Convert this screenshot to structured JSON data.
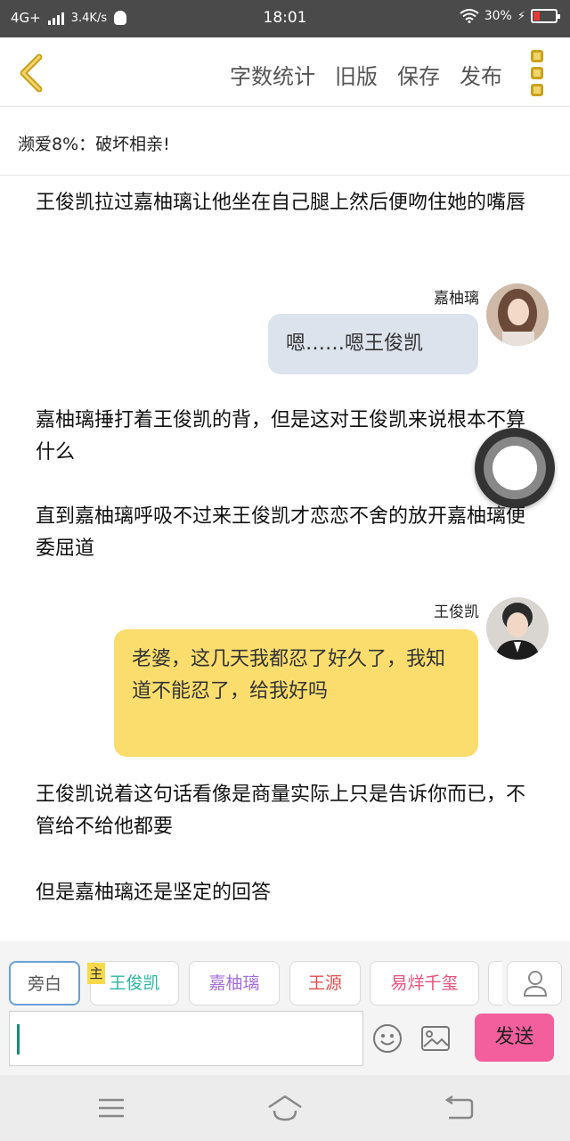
{
  "status_bar": {
    "network": "4G+",
    "speed": "3.4K/s",
    "time": "18:01",
    "battery": "30%",
    "battery_level": 0.3
  },
  "top_bar": {
    "actions": [
      "字数统计",
      "旧版",
      "保存",
      "发布"
    ]
  },
  "chapter": {
    "title": "濒爱8%：破坏相亲!"
  },
  "story": {
    "para1": "王俊凯拉过嘉柚璃让他坐在自己腿上然后便吻住她的嘴唇",
    "msg1": {
      "speaker": "嘉柚璃",
      "text": "嗯……嗯王俊凯"
    },
    "para2": "嘉柚璃捶打着王俊凯的背，但是这对王俊凯来说根本不算什么",
    "para3": "直到嘉柚璃呼吸不过来王俊凯才恋恋不舍的放开嘉柚璃便委屈道",
    "msg2": {
      "speaker": "王俊凯",
      "text": "老婆，这几天我都忍了好久了，我知道不能忍了，给我好吗"
    },
    "para4": "王俊凯说着这句话看像是商量实际上只是告诉你而已，不管给不给他都要",
    "para5": "但是嘉柚璃还是坚定的回答"
  },
  "roles": {
    "narration": "旁白",
    "main_tag": "主",
    "items": [
      {
        "name": "王俊凯",
        "color": "#2cb5a0"
      },
      {
        "name": "嘉柚璃",
        "color": "#a46fd8"
      },
      {
        "name": "王源",
        "color": "#e05050"
      },
      {
        "name": "易烊千玺",
        "color": "#e8507a"
      }
    ]
  },
  "composer": {
    "send_label": "发送"
  },
  "colors": {
    "bubble_left": "#dde3ec",
    "bubble_right": "#fbdd6e",
    "send_button": "#f35e9c",
    "accent": "#c9a21a"
  }
}
